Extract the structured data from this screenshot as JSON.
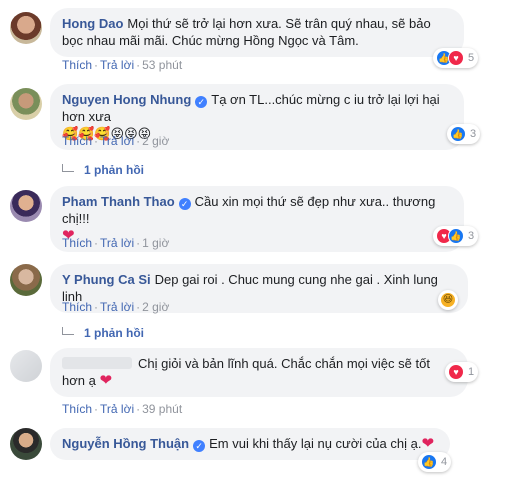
{
  "actions": {
    "like": "Thích",
    "reply": "Trả lời",
    "dot": "·"
  },
  "comments": [
    {
      "author": "Hong Dao",
      "verified": false,
      "text": "Mọi thứ sẽ trở lại hơn xưa. Sẽ trân quý nhau, sẽ bảo bọc nhau mãi mãi. Chúc mừng Hồng Ngọc và Tâm.",
      "time": "53 phút",
      "reactions": [
        "like",
        "love"
      ],
      "reaction_count": "5"
    },
    {
      "author": "Nguyen Hong Nhung",
      "verified": true,
      "text": "Tạ ơn TL...chúc mừng c iu trở lại lợi hại hơn xưa",
      "emoji": "🥰🥰🥰😝😝😝",
      "time": "2 giờ",
      "reactions": [
        "like"
      ],
      "reaction_count": "3",
      "replies": "1 phản hồi"
    },
    {
      "author": "Pham Thanh Thao",
      "verified": true,
      "text": "Cầu xin mọi thứ sẽ đẹp như xưa.. thương chị!!!",
      "emoji": "❤",
      "time": "1 giờ",
      "reactions": [
        "love",
        "like"
      ],
      "reaction_count": "3"
    },
    {
      "author": "Y Phung Ca Si",
      "verified": false,
      "text": "Dep gai roi . Chuc mung cung nhe gai . Xinh lung linh",
      "time": "2 giờ",
      "reactions": [
        "haha"
      ],
      "reaction_count": "",
      "replies": "1 phản hồi"
    },
    {
      "author": "",
      "verified": false,
      "text": "Chị giỏi và bản lĩnh quá. Chắc chắn mọi việc sẽ tốt hơn ạ",
      "emoji": "❤",
      "time": "39 phút",
      "reactions": [
        "love"
      ],
      "reaction_count": "1"
    },
    {
      "author": "Nguyễn Hồng Thuận",
      "verified": true,
      "text": "Em vui khi thấy lại nụ cười của chị ạ.",
      "emoji": "❤",
      "time": "",
      "reactions": [
        "like"
      ],
      "reaction_count": "4"
    }
  ]
}
